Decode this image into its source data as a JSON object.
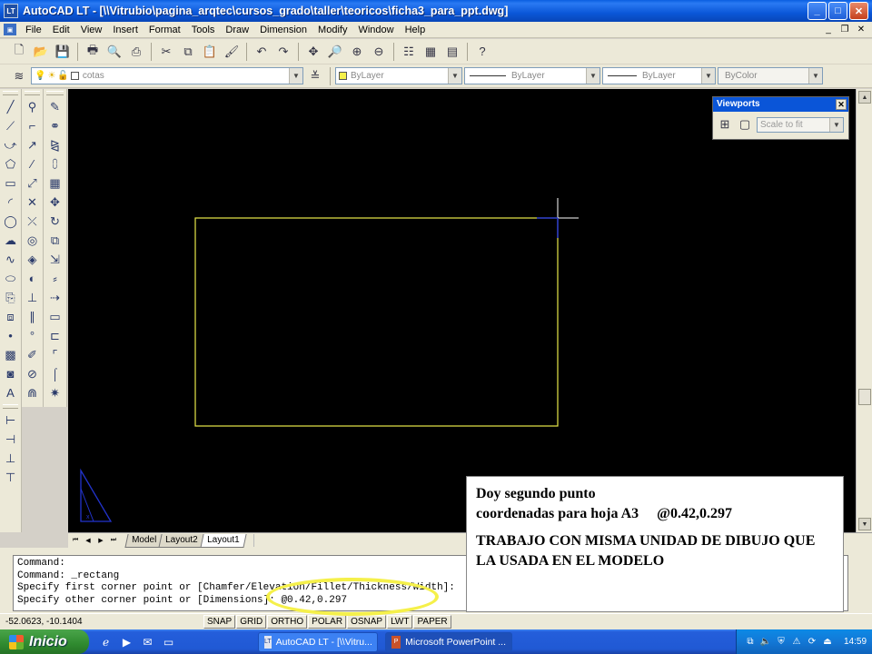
{
  "window": {
    "title": "AutoCAD LT - [\\\\Vitrubio\\pagina_arqtec\\cursos_grado\\taller\\teoricos\\ficha3_para_ppt.dwg]",
    "app_icon_label": "LT",
    "controls": {
      "minimize": "_",
      "maximize": "□",
      "close": "✕"
    }
  },
  "menubar": {
    "items": [
      "File",
      "Edit",
      "View",
      "Insert",
      "Format",
      "Tools",
      "Draw",
      "Dimension",
      "Modify",
      "Window",
      "Help"
    ],
    "doc_controls": {
      "minimize": "_",
      "restore": "❐",
      "close": "✕"
    }
  },
  "properties_toolbar": {
    "layer": "cotas",
    "color": "ByLayer",
    "linetype": "ByLayer",
    "lineweight": "ByLayer",
    "plotstyle": "ByColor"
  },
  "viewports_toolbar": {
    "title": "Viewports",
    "scale": "Scale to fit"
  },
  "layout_tabs": {
    "items": [
      "Model",
      "Layout2",
      "Layout1"
    ],
    "active": "Layout1"
  },
  "command_line": {
    "lines": [
      "Command:",
      "Command: _rectang",
      "Specify first corner point or [Chamfer/Elevation/Fillet/Thickness/Width]:",
      "Specify other corner point or [Dimensions]: @0.42,0.297"
    ]
  },
  "statusbar": {
    "coords": "-52.0623, -10.1404",
    "toggles": [
      "SNAP",
      "GRID",
      "ORTHO",
      "POLAR",
      "OSNAP",
      "LWT",
      "PAPER"
    ]
  },
  "taskbar": {
    "start_label": "Inicio",
    "tasks": [
      {
        "label": "AutoCAD LT - [\\\\Vitru...",
        "icon_label": "LT"
      },
      {
        "label": "Microsoft PowerPoint ...",
        "icon_label": "P"
      }
    ],
    "clock": "14:59"
  },
  "annotation": {
    "line1": "Doy segundo punto",
    "line2": "coordenadas para hoja A3     @0.42,0.297",
    "line3": "TRABAJO CON MISMA UNIDAD DE DIBUJO QUE LA USADA EN EL MODELO"
  },
  "colors": {
    "drawing_background": "#000000",
    "rectangle_stroke": "#e8e84a",
    "crosshair": "#ffffff",
    "ucs_icon": "#2233cc",
    "highlight_oval": "#f5f04a",
    "titlebar": "#0b57d8"
  }
}
